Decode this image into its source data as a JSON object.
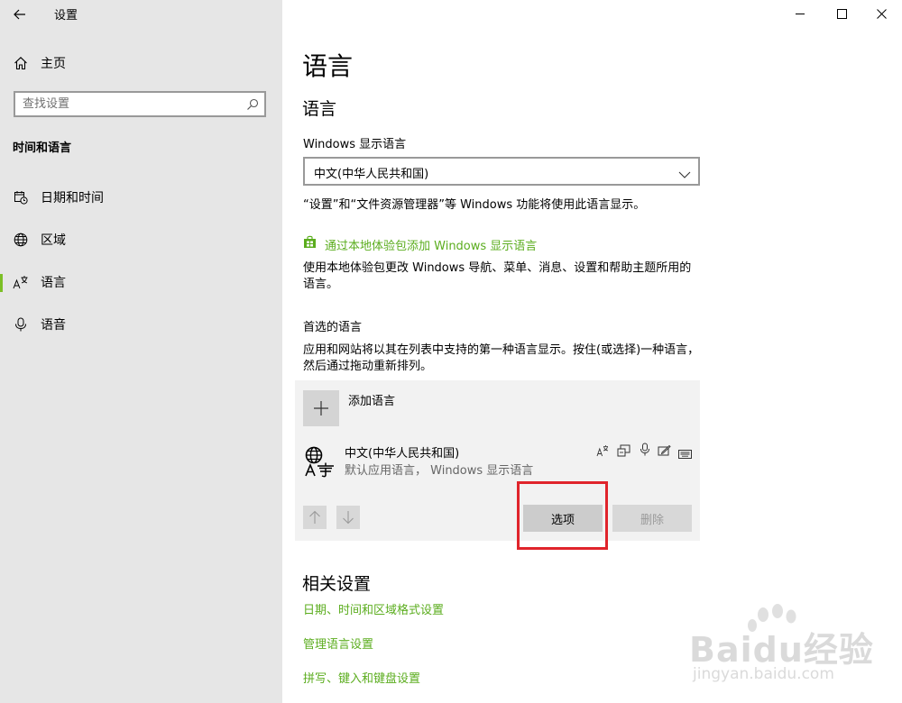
{
  "window": {
    "title": "设置"
  },
  "sidebar": {
    "home_label": "主页",
    "search_placeholder": "查找设置",
    "section_title": "时间和语言",
    "items": [
      {
        "label": "日期和时间",
        "icon": "calendar-clock-icon"
      },
      {
        "label": "区域",
        "icon": "globe-icon"
      },
      {
        "label": "语言",
        "icon": "language-icon",
        "active": true
      },
      {
        "label": "语音",
        "icon": "microphone-icon"
      }
    ]
  },
  "main": {
    "page_title": "语言",
    "section_language": "语言",
    "display_language_label": "Windows 显示语言",
    "display_language_value": "中文(中华人民共和国)",
    "display_language_note": "“设置”和“文件资源管理器”等 Windows 功能将使用此语言显示。",
    "add_pack_link": "通过本地体验包添加 Windows 显示语言",
    "pack_description": "使用本地体验包更改 Windows 导航、菜单、消息、设置和帮助主题所用的语言。",
    "preferred_title": "首选的语言",
    "preferred_description": "应用和网站将以其在列表中支持的第一种语言显示。按住(或选择)一种语言，然后通过拖动重新排列。",
    "add_language_label": "添加语言",
    "language_item": {
      "name": "中文(中华人民共和国)",
      "subtitle": "默认应用语言， Windows 显示语言"
    },
    "options_button": "选项",
    "delete_button": "删除",
    "related_title": "相关设置",
    "related_links": [
      "日期、时间和区域格式设置",
      "管理语言设置",
      "拼写、键入和键盘设置"
    ]
  },
  "watermark": {
    "brand": "Baidu经验",
    "url": "jingyan.baidu.com"
  },
  "colors": {
    "accent_green": "#5bad1e",
    "highlight_red": "#e0242b",
    "sidebar_bg": "#e6e6e6"
  }
}
